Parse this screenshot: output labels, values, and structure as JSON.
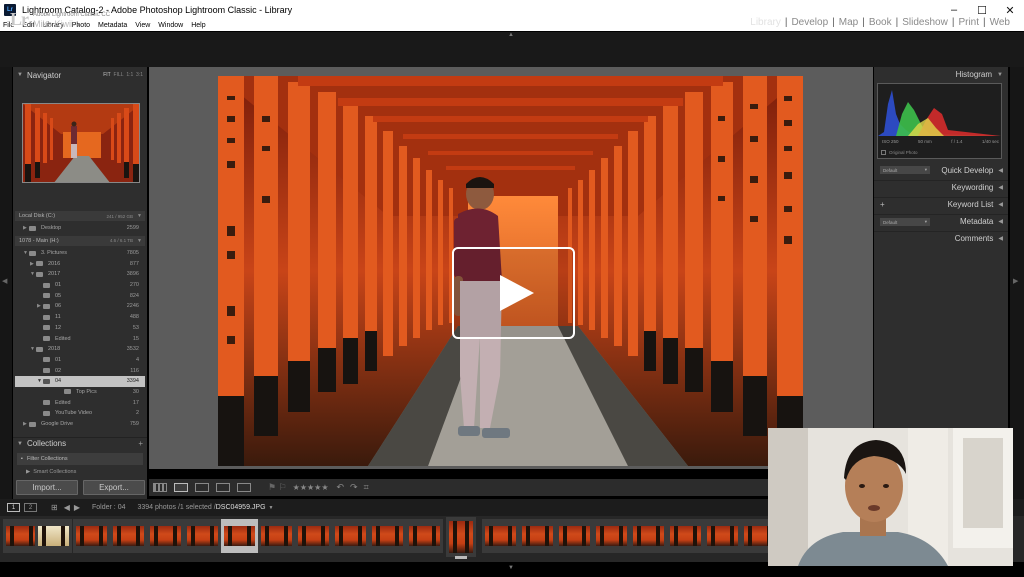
{
  "window": {
    "title": "Lightroom Catalog-2 - Adobe Photoshop Lightroom Classic - Library",
    "controls": [
      "–",
      "☐",
      "✕"
    ]
  },
  "menu": [
    "File",
    "Edit",
    "Library",
    "Photo",
    "Metadata",
    "View",
    "Window",
    "Help"
  ],
  "identity": {
    "logo": "Lr",
    "app_name": "Adobe Lightroom Classic CC",
    "user": "Mike Kiwii",
    "user_caret": "▼"
  },
  "modules": [
    {
      "label": "Library",
      "active": true
    },
    {
      "label": "Develop"
    },
    {
      "label": "Map"
    },
    {
      "label": "Book"
    },
    {
      "label": "Slideshow"
    },
    {
      "label": "Print"
    },
    {
      "label": "Web"
    }
  ],
  "navigator": {
    "title": "Navigator",
    "zoom": [
      "FIT",
      "FILL",
      "1:1",
      "3:1"
    ]
  },
  "volumes": [
    {
      "name": "Local Disk (C:)",
      "meta": "241 / 952 GB"
    },
    {
      "name": "1078 - Main (H:)",
      "meta": "4.6 / 6.1 TB"
    }
  ],
  "folders": [
    {
      "indent": 0,
      "tri": "▶",
      "name": "Desktop",
      "count": "2599"
    },
    {
      "indent": 0,
      "tri": "",
      "name": "",
      "count": ""
    },
    {
      "indent": 1,
      "tri": "▼",
      "name": "3. Pictures",
      "count": "7805"
    },
    {
      "indent": 2,
      "tri": "▶",
      "name": "2016",
      "count": "877"
    },
    {
      "indent": 2,
      "tri": "▼",
      "name": "2017",
      "count": "3896"
    },
    {
      "indent": 3,
      "tri": "",
      "name": "01",
      "count": "270"
    },
    {
      "indent": 3,
      "tri": "",
      "name": "05",
      "count": "824"
    },
    {
      "indent": 3,
      "tri": "▶",
      "name": "06",
      "count": "2246"
    },
    {
      "indent": 3,
      "tri": "",
      "name": "11",
      "count": "488"
    },
    {
      "indent": 3,
      "tri": "",
      "name": "12",
      "count": "53"
    },
    {
      "indent": 3,
      "tri": "",
      "name": "Edited",
      "count": "15"
    },
    {
      "indent": 2,
      "tri": "▼",
      "name": "2018",
      "count": "3532"
    },
    {
      "indent": 3,
      "tri": "",
      "name": "01",
      "count": "4"
    },
    {
      "indent": 3,
      "tri": "",
      "name": "02",
      "count": "116"
    },
    {
      "indent": 3,
      "tri": "▼",
      "name": "04",
      "count": "3394",
      "selected": true
    },
    {
      "indent": 4,
      "tri": "",
      "name": "Top Pics",
      "count": "30"
    },
    {
      "indent": 3,
      "tri": "",
      "name": "Edited",
      "count": "17"
    },
    {
      "indent": 3,
      "tri": "",
      "name": "YouTube Video",
      "count": "2"
    },
    {
      "indent": 0,
      "tri": "▶",
      "name": "Google Drive",
      "count": "759"
    }
  ],
  "collections": {
    "title": "Collections",
    "items": [
      "Filter Collections",
      "Smart Collections"
    ]
  },
  "buttons": {
    "import": "Import...",
    "export": "Export..."
  },
  "histogram": {
    "title": "Histogram",
    "exif": [
      "ISO 250",
      "50 mm",
      "f / 1.4",
      "1/40 sec"
    ],
    "original": "Original Photo"
  },
  "right_panels": [
    {
      "label": "Quick Develop",
      "preset": "Default"
    },
    {
      "label": "Keywording"
    },
    {
      "label": "Keyword List",
      "plus": "+"
    },
    {
      "label": "Metadata",
      "preset": "Default"
    },
    {
      "label": "Comments"
    }
  ],
  "toolbar": {
    "stars": "★★★★★"
  },
  "filmstrip": {
    "pages": [
      "1",
      "2"
    ],
    "folder": "Folder : 04",
    "count": "3394 photos /1 selected /",
    "filename": "DSC04959.JPG",
    "caret": "▼"
  },
  "colors": {
    "panel": "#2e2e2e",
    "center": "#5c5c5c",
    "selected_folder": "#c3c3c3",
    "torii": "#d9471a"
  }
}
